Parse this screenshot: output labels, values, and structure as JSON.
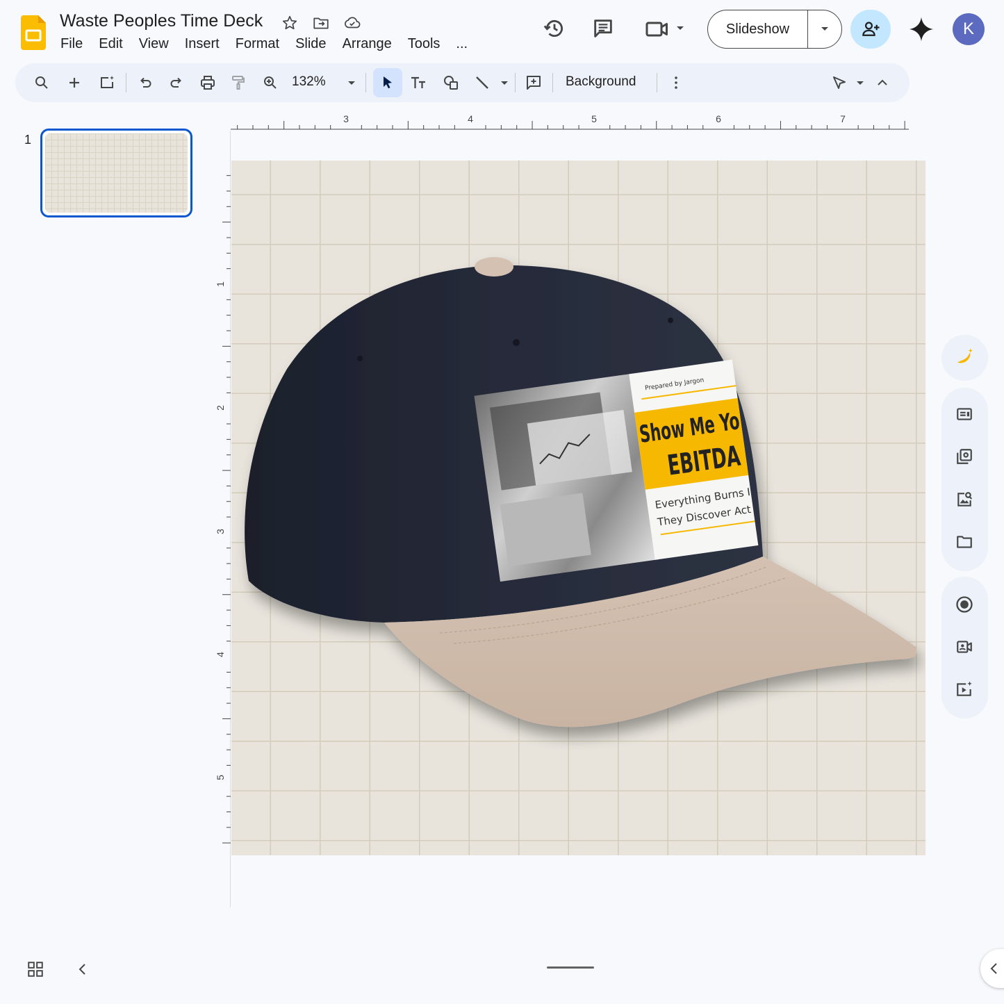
{
  "app": {
    "doc_title": "Waste Peoples Time Deck",
    "menu": [
      "File",
      "Edit",
      "View",
      "Insert",
      "Format",
      "Slide",
      "Arrange",
      "Tools",
      "..."
    ],
    "slideshow_label": "Slideshow",
    "avatar_initial": "K",
    "accent_color": "#0b57d0",
    "share_color": "#c2e7ff"
  },
  "toolbar": {
    "zoom": "132%",
    "background_label": "Background"
  },
  "filmstrip": {
    "slides": [
      {
        "number": "1"
      }
    ]
  },
  "ruler": {
    "top_labels": [
      "3",
      "4",
      "5",
      "6",
      "7"
    ],
    "left_labels": [
      "1",
      "2",
      "3",
      "4",
      "5"
    ]
  },
  "slide": {
    "image": {
      "subject": "navy baseball cap with tan brim and printed patch",
      "patch_prepared_by": "Prepared by Jargon",
      "patch_headline_1": "Show Me Yo",
      "patch_headline_2": "EBITDA",
      "patch_tagline_1": "Everything Burns I",
      "patch_tagline_2": "They Discover Act"
    }
  },
  "side_panel": {
    "icons": [
      "banana-sparkle-icon",
      "speaker-notes-icon",
      "slide-library-icon",
      "image-search-icon",
      "folder-icon",
      "record-icon",
      "camera-icon",
      "video-sparkle-icon"
    ]
  }
}
